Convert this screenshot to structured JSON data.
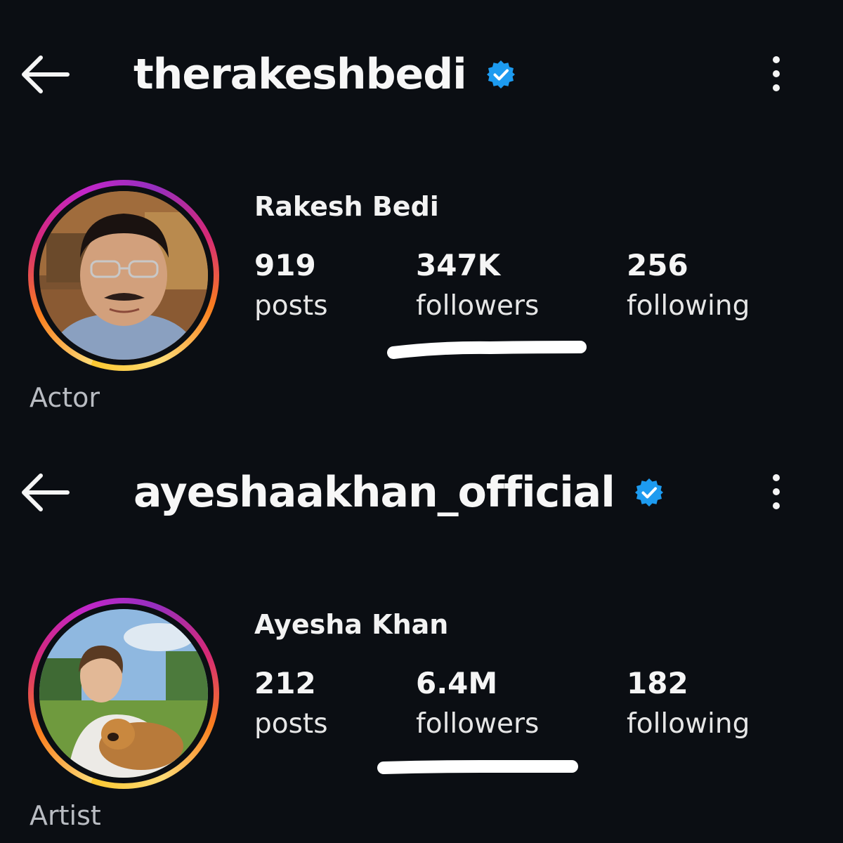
{
  "profiles": [
    {
      "username": "therakeshbedi",
      "display_name": "Rakesh Bedi",
      "posts_count": "919",
      "posts_label": "posts",
      "followers_count": "347K",
      "followers_label": "followers",
      "following_count": "256",
      "following_label": "following",
      "category": "Actor",
      "verified": true
    },
    {
      "username": "ayeshaakhan_official",
      "display_name": "Ayesha Khan",
      "posts_count": "212",
      "posts_label": "posts",
      "followers_count": "6.4M",
      "followers_label": "followers",
      "following_count": "182",
      "following_label": "following",
      "category": "Artist",
      "verified": true
    }
  ],
  "icons": {
    "back": "arrow-left-icon",
    "verified": "verified-badge-icon",
    "menu": "more-vertical-icon"
  },
  "colors": {
    "background": "#0b0e13",
    "verified_blue": "#1d9bf0",
    "text": "#f5f5f5",
    "category_text": "#b9bcc2",
    "annotation": "#ffffff"
  }
}
